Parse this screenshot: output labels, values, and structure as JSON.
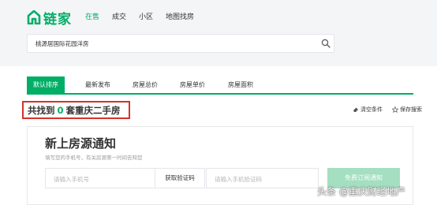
{
  "header": {
    "logo_text": "链家",
    "nav": [
      {
        "label": "在售",
        "active": true
      },
      {
        "label": "成交",
        "active": false
      },
      {
        "label": "小区",
        "active": false
      },
      {
        "label": "地图找房",
        "active": false
      }
    ],
    "search_value": "桃源居国际花园洋房",
    "brand_color": "#00ae66"
  },
  "sort_tabs": [
    "默认排序",
    "最新发布",
    "房屋总价",
    "房屋单价",
    "房屋面积"
  ],
  "result": {
    "prefix": "共找到",
    "count": "0",
    "suffix": "套重庆二手房"
  },
  "actions": {
    "clear": "清空条件",
    "save": "保存搜索"
  },
  "notify": {
    "title": "新上房源通知",
    "subtitle": "填写您的手机号，有关房源第一时间告知您",
    "phone_placeholder": "请输入手机号",
    "get_code": "获取验证码",
    "code_placeholder": "请输入手机验证码",
    "submit": "免费订阅通知"
  },
  "watermark": "头条 @重庆财经地产"
}
